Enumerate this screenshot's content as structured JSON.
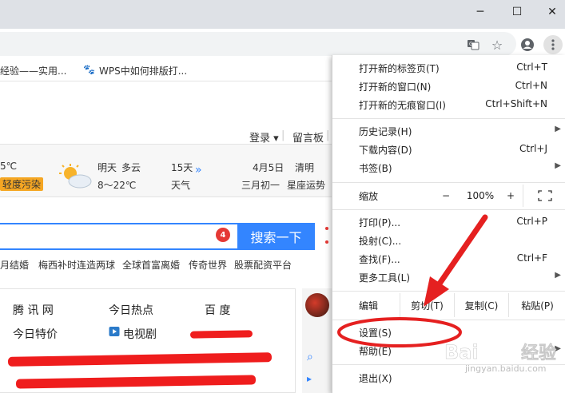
{
  "window": {
    "minimize_icon": "minimize-icon",
    "maximize_icon": "maximize-icon",
    "close_icon": "close-icon"
  },
  "toolbar": {
    "translate_icon": "translate-icon",
    "star_icon": "star-icon",
    "account_icon": "account-icon",
    "menu_icon": "three-dot-menu-icon"
  },
  "bookmarks": [
    {
      "label": "经验——实用..."
    },
    {
      "label": "WPS中如何排版打..."
    }
  ],
  "page": {
    "login": "登录",
    "guestbook": "留言板",
    "weather": {
      "temp_today": "5℃",
      "pollution": "轻度污染",
      "tomorrow": "明天",
      "condition": "多云",
      "temp_range": "8～22℃",
      "forecast_days": "15天",
      "forecast_label": "天气",
      "date": "4月5日",
      "festival": "清明",
      "lunar": "三月初一",
      "almanac": "星座运势"
    },
    "search": {
      "badge_count": "4",
      "button": "搜索一下"
    },
    "hot_topics": [
      "月结婚",
      "梅西补时连造两球",
      "全球首富离婚",
      "传奇世界",
      "股票配资平台"
    ],
    "nav": {
      "row1": [
        "腾 讯 网",
        "今日热点",
        "百  度"
      ],
      "row2": [
        "今日特价",
        "电视剧"
      ]
    }
  },
  "menu": {
    "items": [
      {
        "label": "打开新的标签页(T)",
        "shortcut": "Ctrl+T"
      },
      {
        "label": "打开新的窗口(N)",
        "shortcut": "Ctrl+N"
      },
      {
        "label": "打开新的无痕窗口(I)",
        "shortcut": "Ctrl+Shift+N"
      },
      {
        "label": "历史记录(H)",
        "submenu": true
      },
      {
        "label": "下载内容(D)",
        "shortcut": "Ctrl+J"
      },
      {
        "label": "书签(B)",
        "submenu": true
      }
    ],
    "zoom": {
      "label": "缩放",
      "minus": "−",
      "value": "100%",
      "plus": "+"
    },
    "items2": [
      {
        "label": "打印(P)...",
        "shortcut": "Ctrl+P"
      },
      {
        "label": "投射(C)..."
      },
      {
        "label": "查找(F)...",
        "shortcut": "Ctrl+F"
      },
      {
        "label": "更多工具(L)",
        "submenu": true
      }
    ],
    "edit": {
      "label": "编辑",
      "cut": "剪切(T)",
      "copy": "复制(C)",
      "paste": "粘贴(P)"
    },
    "items3": [
      {
        "label": "设置(S)"
      },
      {
        "label": "帮助(E)",
        "submenu": true
      }
    ],
    "exit": "退出(X)"
  },
  "watermark": {
    "brand": "Baidu经验",
    "url": "jingyan.baidu.com"
  },
  "colors": {
    "search_blue": "#3385ff",
    "annotation_red": "#e52020"
  }
}
